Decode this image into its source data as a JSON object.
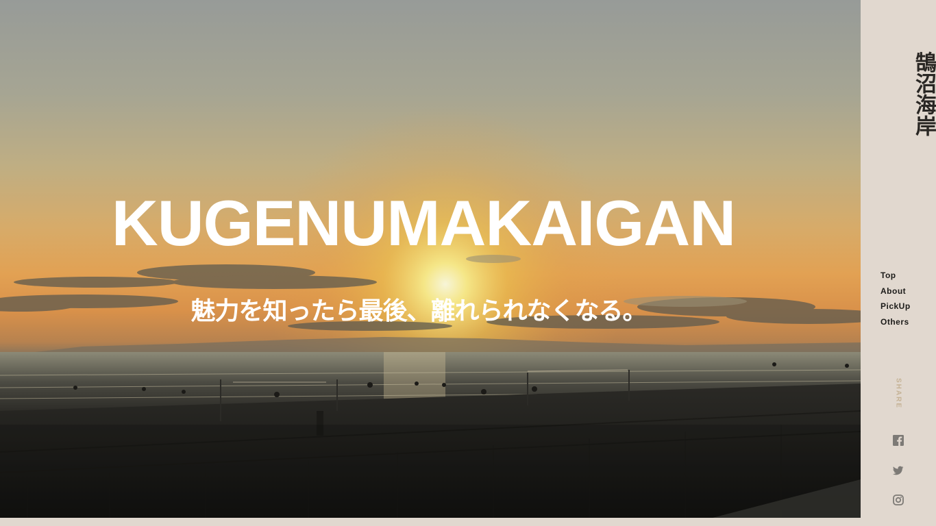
{
  "hero": {
    "title": "KUGENUMAKAIGAN",
    "tagline": "魅力を知ったら最後、離れられなくなる。",
    "background": "sunset-over-beach-photo"
  },
  "sidebar": {
    "logo": "鵠沼海岸",
    "nav": [
      {
        "label": "Top"
      },
      {
        "label": "About"
      },
      {
        "label": "PickUp"
      },
      {
        "label": "Others"
      }
    ],
    "share_label": "SHARE",
    "social": [
      {
        "icon": "facebook-icon"
      },
      {
        "icon": "twitter-icon"
      },
      {
        "icon": "instagram-icon"
      }
    ]
  },
  "colors": {
    "sidebar_bg": "#e1d8cf",
    "text_dark": "#2a2724",
    "share_accent": "#c5b295",
    "icon_gray": "#7d7a76"
  }
}
